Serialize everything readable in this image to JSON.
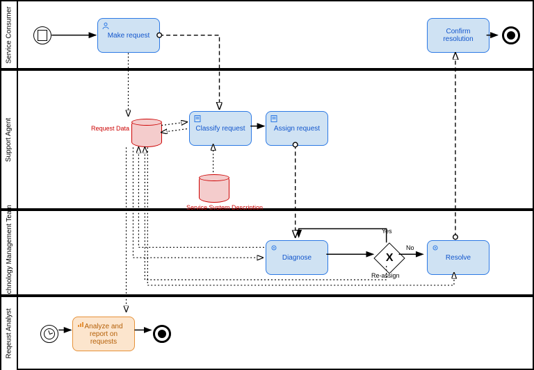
{
  "lanes": {
    "consumer": "Service Consumer",
    "agent": "Support Agent",
    "tech": "Technology Management Team",
    "analyst": "Reqeust Analyst"
  },
  "tasks": {
    "make_request": "Make request",
    "classify": "Classify request",
    "assign": "Assign request",
    "diagnose": "Diagnose",
    "resolve": "Resolve",
    "confirm": "Confirm resolution",
    "analyze": "Analyze and report on requests"
  },
  "data_objects": {
    "request_data": "Request Data",
    "service_system": "Service System Description"
  },
  "gateway": {
    "yes": "Yes",
    "no": "No",
    "reassign": "Re-assign"
  }
}
